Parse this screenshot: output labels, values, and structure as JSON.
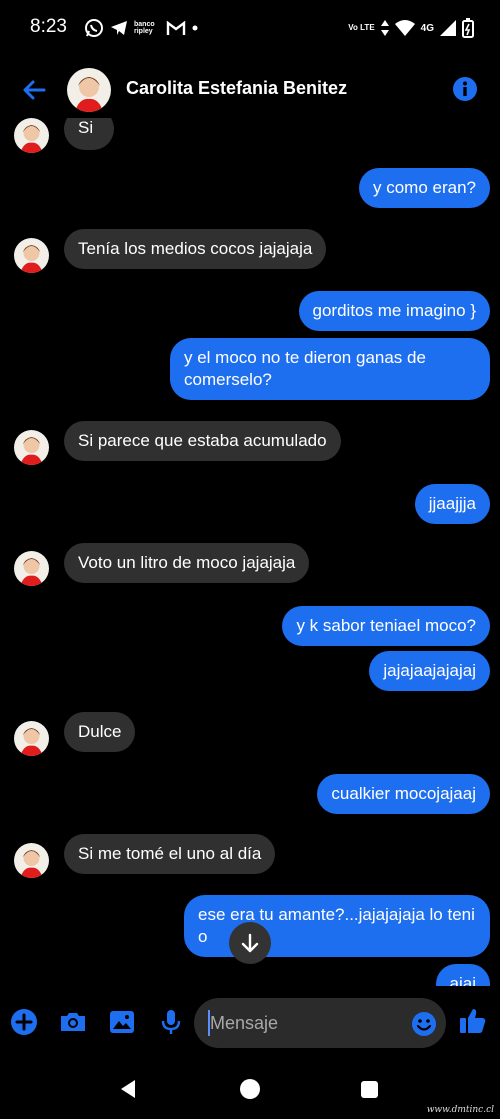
{
  "status_bar": {
    "time": "8:23",
    "bank_label": "banco ripley",
    "volte_label": "Vo LTE",
    "network": "4G"
  },
  "header": {
    "contact_name": "Carolita Estefania Benitez",
    "back_icon": "arrow-left-icon",
    "info_icon": "info-icon"
  },
  "messages": [
    {
      "side": "in",
      "text": "Si"
    },
    {
      "side": "out",
      "text": "y como eran?"
    },
    {
      "side": "in",
      "text": "Tenía los medios cocos jajajaja"
    },
    {
      "side": "out",
      "text": "gorditos me imagino }"
    },
    {
      "side": "out",
      "text": "y el moco no te dieron ganas de comerselo?"
    },
    {
      "side": "in",
      "text": "Si parece que estaba acumulado"
    },
    {
      "side": "out",
      "text": "jjaajjja"
    },
    {
      "side": "in",
      "text": "Voto un litro de moco jajajaja"
    },
    {
      "side": "out",
      "text": "y k sabor teniael moco?"
    },
    {
      "side": "out",
      "text": "jajajaajajajaj"
    },
    {
      "side": "in",
      "text": "Dulce"
    },
    {
      "side": "out",
      "text": "cualkier mocojajaaj"
    },
    {
      "side": "in",
      "text": "Si me tomé el uno al día"
    },
    {
      "side": "out",
      "text": "ese era tu amante?...jajajajaja lo teni   o"
    },
    {
      "side": "out",
      "text": "ajaj"
    }
  ],
  "composer": {
    "placeholder": "Mensaje",
    "icons": [
      "plus-icon",
      "camera-icon",
      "gallery-icon",
      "mic-icon",
      "emoji-icon",
      "thumbs-up-icon"
    ]
  },
  "colors": {
    "accent": "#1e6ff0",
    "incoming_bubble": "#303030",
    "background": "#000000"
  },
  "watermark": "www.dmtinc.cl"
}
